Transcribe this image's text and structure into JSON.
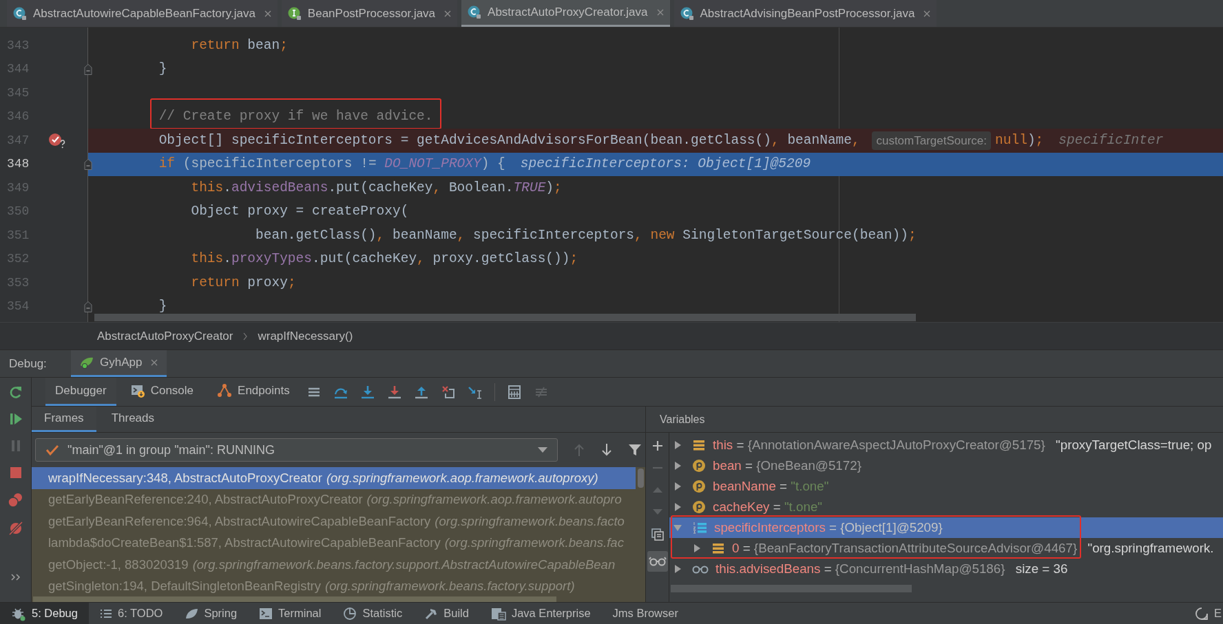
{
  "editor_tabs": [
    {
      "label": "AbstractAutowireCapableBeanFactory.java",
      "kind": "class",
      "selected": false
    },
    {
      "label": "BeanPostProcessor.java",
      "kind": "interface",
      "selected": false
    },
    {
      "label": "AbstractAutoProxyCreator.java",
      "kind": "class",
      "selected": true
    },
    {
      "label": "AbstractAdvisingBeanPostProcessor.java",
      "kind": "class",
      "selected": false
    }
  ],
  "code_lines": [
    {
      "number": "343",
      "breakpoint": false,
      "execution_point": false,
      "foldable": false,
      "segments": [
        {
          "text": "            return",
          "kind": "kw"
        },
        {
          "text": " bean",
          "kind": "plain"
        },
        {
          "text": ";",
          "kind": "kw"
        }
      ]
    },
    {
      "number": "344",
      "breakpoint": false,
      "execution_point": false,
      "foldable": true,
      "segments": [
        {
          "text": "        }",
          "kind": "plain"
        }
      ]
    },
    {
      "number": "345",
      "breakpoint": false,
      "execution_point": false,
      "foldable": false
    },
    {
      "number": "346",
      "breakpoint": false,
      "execution_point": false,
      "foldable": false,
      "segments": [
        {
          "text": "        // Create proxy if we have advice.",
          "kind": "comment",
          "annotated": true
        }
      ]
    },
    {
      "number": "347",
      "breakpoint": true,
      "execution_point": false,
      "foldable": false,
      "segments": [
        {
          "text": "        Object[] specificInterceptors = getAdvicesAndAdvisorsForBean(bean.getClass()",
          "kind": "plain"
        },
        {
          "text": ",",
          "kind": "kw"
        },
        {
          "text": " beanName",
          "kind": "plain"
        },
        {
          "text": ", ",
          "kind": "kw"
        },
        {
          "text": "customTargetSource:",
          "kind": "inlay"
        },
        {
          "text": "null",
          "kind": "kw"
        },
        {
          "text": ")",
          "kind": "plain"
        },
        {
          "text": ";",
          "kind": "kw"
        },
        {
          "text": "specificInter",
          "kind": "hint"
        }
      ]
    },
    {
      "number": "348",
      "breakpoint": false,
      "execution_point": true,
      "foldable": true,
      "segments": [
        {
          "text": "        if",
          "kind": "kw"
        },
        {
          "text": " (specificInterceptors != ",
          "kind": "plain"
        },
        {
          "text": "DO_NOT_PROXY",
          "kind": "const"
        },
        {
          "text": ") {",
          "kind": "plain"
        },
        {
          "text": "specificInterceptors: Object[1]@5209",
          "kind": "hint"
        }
      ]
    },
    {
      "number": "349",
      "breakpoint": false,
      "execution_point": false,
      "foldable": false,
      "segments": [
        {
          "text": "            this",
          "kind": "kw"
        },
        {
          "text": ".",
          "kind": "plain"
        },
        {
          "text": "advisedBeans",
          "kind": "field"
        },
        {
          "text": ".put(cacheKey",
          "kind": "plain"
        },
        {
          "text": ",",
          "kind": "kw"
        },
        {
          "text": " Boolean.",
          "kind": "plain"
        },
        {
          "text": "TRUE",
          "kind": "const"
        },
        {
          "text": ")",
          "kind": "plain"
        },
        {
          "text": ";",
          "kind": "kw"
        }
      ]
    },
    {
      "number": "350",
      "breakpoint": false,
      "execution_point": false,
      "foldable": false,
      "segments": [
        {
          "text": "            Object proxy = createProxy(",
          "kind": "plain"
        }
      ]
    },
    {
      "number": "351",
      "breakpoint": false,
      "execution_point": false,
      "foldable": false,
      "segments": [
        {
          "text": "                    bean.getClass()",
          "kind": "plain"
        },
        {
          "text": ",",
          "kind": "kw"
        },
        {
          "text": " beanName",
          "kind": "plain"
        },
        {
          "text": ",",
          "kind": "kw"
        },
        {
          "text": " specificInterceptors",
          "kind": "plain"
        },
        {
          "text": ", new",
          "kind": "kw"
        },
        {
          "text": " SingletonTargetSource(bean))",
          "kind": "plain"
        },
        {
          "text": ";",
          "kind": "kw"
        }
      ]
    },
    {
      "number": "352",
      "breakpoint": false,
      "execution_point": false,
      "foldable": false,
      "segments": [
        {
          "text": "            this",
          "kind": "kw"
        },
        {
          "text": ".",
          "kind": "plain"
        },
        {
          "text": "proxyTypes",
          "kind": "field"
        },
        {
          "text": ".put(cacheKey",
          "kind": "plain"
        },
        {
          "text": ",",
          "kind": "kw"
        },
        {
          "text": " proxy.getClass())",
          "kind": "plain"
        },
        {
          "text": ";",
          "kind": "kw"
        }
      ]
    },
    {
      "number": "353",
      "breakpoint": false,
      "execution_point": false,
      "foldable": false,
      "segments": [
        {
          "text": "            return",
          "kind": "kw"
        },
        {
          "text": " proxy",
          "kind": "plain"
        },
        {
          "text": ";",
          "kind": "kw"
        }
      ]
    },
    {
      "number": "354",
      "breakpoint": false,
      "execution_point": false,
      "foldable": true,
      "segments": [
        {
          "text": "        }",
          "kind": "plain"
        }
      ]
    }
  ],
  "breadcrumb": [
    "AbstractAutoProxyCreator",
    "wrapIfNecessary()"
  ],
  "debug_header": {
    "label": "Debug:",
    "session": "GyhApp"
  },
  "debugger_tabs": [
    {
      "label": "Debugger",
      "selected": true
    },
    {
      "label": "Console",
      "selected": false
    },
    {
      "label": "Endpoints",
      "selected": false
    }
  ],
  "frames_tabs": [
    {
      "label": "Frames",
      "selected": true
    },
    {
      "label": "Threads",
      "selected": false
    }
  ],
  "thread_dropdown": {
    "value": "\"main\"@1 in group \"main\": RUNNING"
  },
  "frames": [
    {
      "location": "wrapIfNecessary:348, AbstractAutoProxyCreator",
      "package": "(org.springframework.aop.framework.autoproxy)",
      "selected": true
    },
    {
      "location": "getEarlyBeanReference:240, AbstractAutoProxyCreator",
      "package": "(org.springframework.aop.framework.autopro",
      "selected": false
    },
    {
      "location": "getEarlyBeanReference:964, AbstractAutowireCapableBeanFactory",
      "package": "(org.springframework.beans.facto",
      "selected": false
    },
    {
      "location": "lambda$doCreateBean$1:587, AbstractAutowireCapableBeanFactory",
      "package": "(org.springframework.beans.fac",
      "selected": false
    },
    {
      "location": "getObject:-1, 883020319",
      "package": "(org.springframework.beans.factory.support.AbstractAutowireCapableBean",
      "selected": false
    },
    {
      "location": "getSingleton:194, DefaultSingletonBeanRegistry",
      "package": "(org.springframework.beans.factory.support)",
      "selected": false
    }
  ],
  "variables_title": "Variables",
  "variables": [
    {
      "kind": "field",
      "expanded": false,
      "selected": false,
      "annotated": false,
      "segments": [
        {
          "text": "this",
          "kind": "name"
        },
        {
          "text": " = ",
          "kind": "op"
        },
        {
          "text": "{AnnotationAwareAspectJAutoProxyCreator@5175}",
          "kind": "object"
        },
        {
          "text": " \"proxyTargetClass=true; op",
          "kind": "extra"
        }
      ]
    },
    {
      "kind": "param",
      "expanded": false,
      "selected": false,
      "annotated": false,
      "segments": [
        {
          "text": "bean",
          "kind": "name"
        },
        {
          "text": " = ",
          "kind": "op"
        },
        {
          "text": "{OneBean@5172}",
          "kind": "object"
        }
      ]
    },
    {
      "kind": "param",
      "expanded": false,
      "selected": false,
      "annotated": false,
      "segments": [
        {
          "text": "beanName",
          "kind": "name"
        },
        {
          "text": " = ",
          "kind": "op"
        },
        {
          "text": "\"t.one\"",
          "kind": "string"
        }
      ]
    },
    {
      "kind": "param",
      "expanded": false,
      "selected": false,
      "annotated": false,
      "segments": [
        {
          "text": "cacheKey",
          "kind": "name"
        },
        {
          "text": " = ",
          "kind": "op"
        },
        {
          "text": "\"t.one\"",
          "kind": "string"
        }
      ]
    },
    {
      "kind": "array",
      "expanded": true,
      "selected": true,
      "annotated": true,
      "segments": [
        {
          "text": "specificInterceptors",
          "kind": "name"
        },
        {
          "text": " = {Object[1]@5209}",
          "kind": "op"
        }
      ],
      "children": [
        {
          "kind": "field",
          "expanded": false,
          "selected": false,
          "annotated": false,
          "segments": [
            {
              "text": "0",
              "kind": "name"
            },
            {
              "text": " = ",
              "kind": "op"
            },
            {
              "text": "{BeanFactoryTransactionAttributeSourceAdvisor@4467}",
              "kind": "object"
            },
            {
              "text": " \"org.springframework.",
              "kind": "extra"
            }
          ]
        }
      ]
    },
    {
      "kind": "watch",
      "expanded": false,
      "selected": false,
      "annotated": false,
      "segments": [
        {
          "text": "this.advisedBeans",
          "kind": "name"
        },
        {
          "text": " = ",
          "kind": "op"
        },
        {
          "text": "{ConcurrentHashMap@5186}",
          "kind": "object"
        },
        {
          "text": "  size = 36",
          "kind": "extra"
        }
      ]
    }
  ],
  "status_bar": [
    {
      "label": "5: Debug",
      "kind": "debug",
      "selected": true
    },
    {
      "label": "6: TODO",
      "kind": "list",
      "selected": false
    },
    {
      "label": "Spring",
      "kind": "spring",
      "selected": false
    },
    {
      "label": "Terminal",
      "kind": "terminal",
      "selected": false
    },
    {
      "label": "Statistic",
      "kind": "statistic",
      "selected": false
    },
    {
      "label": "Build",
      "kind": "build",
      "selected": false
    },
    {
      "label": "Java Enterprise",
      "kind": "javaee",
      "selected": false
    },
    {
      "label": "Jms Browser",
      "kind": "none",
      "selected": false
    }
  ],
  "status_right": "E"
}
